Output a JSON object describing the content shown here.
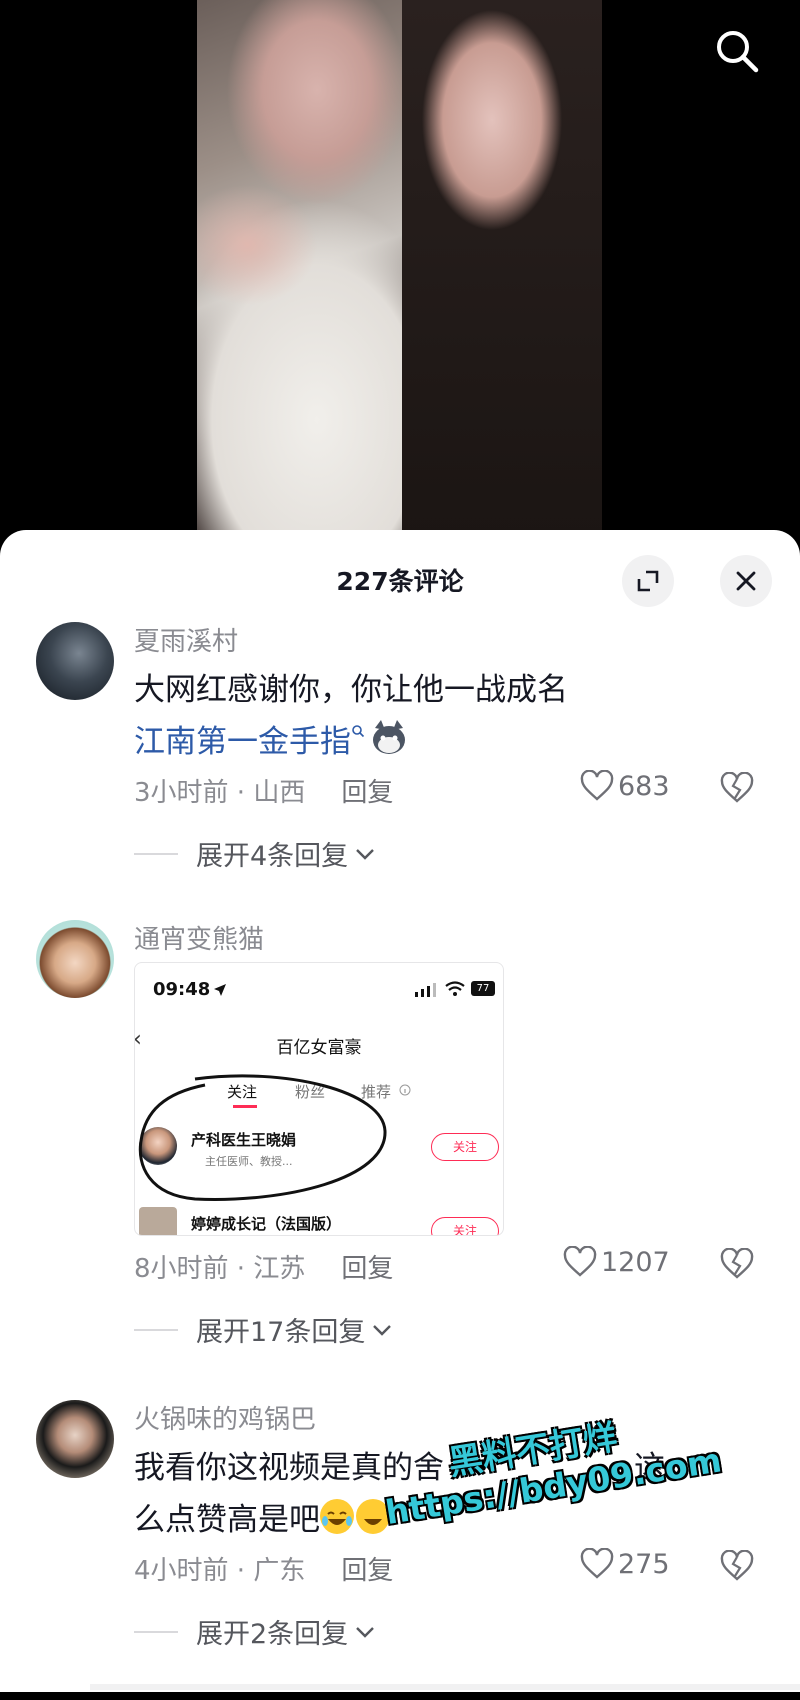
{
  "sheet": {
    "title": "227条评论"
  },
  "comments": [
    {
      "username": "夏雨溪村",
      "text": "大网红感谢你，你让他一战成名",
      "link": "江南第一金手指",
      "time_location": "3小时前 · 山西",
      "reply_label": "回复",
      "likes": "683",
      "expand_label": "展开4条回复"
    },
    {
      "username": "通宵变熊猫",
      "time_location": "8小时前 · 江苏",
      "reply_label": "回复",
      "likes": "1207",
      "expand_label": "展开17条回复",
      "embedded_screenshot": {
        "time": "09:48",
        "battery": "77",
        "title": "百亿女富豪",
        "tabs": [
          "关注",
          "粉丝",
          "推荐"
        ],
        "rows": [
          {
            "name": "产科医生王晓娟",
            "desc": "主任医师、教授...",
            "button": "关注"
          },
          {
            "name": "婷婷成长记（法国版）",
            "button": "关注"
          }
        ]
      }
    },
    {
      "username": "火锅味的鸡锅巴",
      "text_line1": "我看你这视频是真的舍",
      "text_line1_end": "这",
      "text_line2": "么点赞高是吧",
      "time_location": "4小时前 · 广东",
      "reply_label": "回复",
      "likes": "275",
      "expand_label": "展开2条回复"
    }
  ],
  "watermark": {
    "line1": "黑料不打烊",
    "line2": "https://bdy09.com"
  }
}
